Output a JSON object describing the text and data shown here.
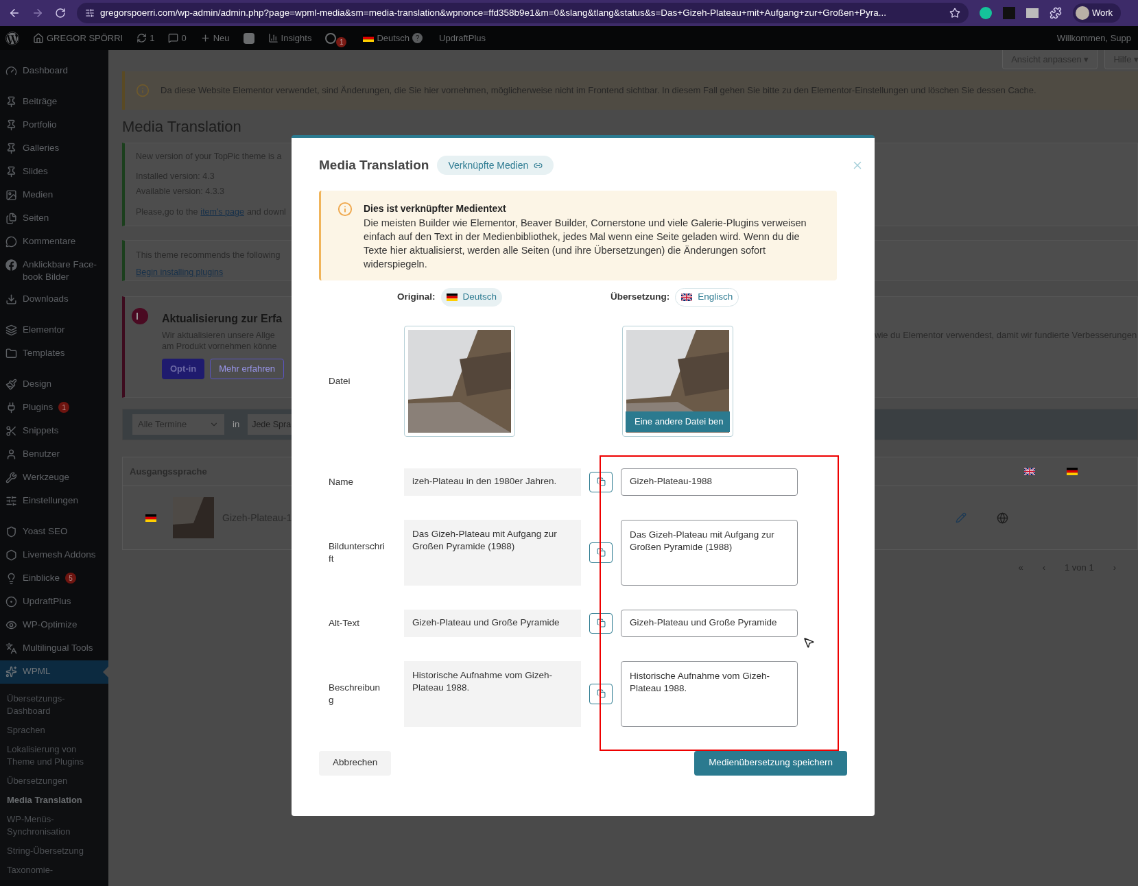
{
  "browser": {
    "url": "gregorspoerri.com/wp-admin/admin.php?page=wpml-media&sm=media-translation&wpnonce=ffd358b9e1&m=0&slang&tlang&status&s=Das+Gizeh-Plateau+mit+Aufgang+zur+Großen+Pyra...",
    "profile": "Work"
  },
  "admin_bar": {
    "site": "GREGOR SPÖRRI",
    "updates": "1",
    "comments": "0",
    "new": "Neu",
    "insights": "Insights",
    "wpml_badge": "1",
    "language": "Deutsch",
    "help": "?",
    "updraft": "UpdraftPlus",
    "welcome": "Willkommen, Supp"
  },
  "sidebar": {
    "groups": [
      [
        {
          "label": "Dashboard",
          "selected": false
        }
      ],
      [
        {
          "label": "Beiträge",
          "selected": false
        },
        {
          "label": "Portfolio",
          "selected": false
        },
        {
          "label": "Galleries",
          "selected": false
        },
        {
          "label": "Slides",
          "selected": false
        },
        {
          "label": "Medien",
          "selected": false
        },
        {
          "label": "Seiten",
          "selected": false
        },
        {
          "label": "Kommentare",
          "selected": false
        },
        {
          "label": "Anklickbare Face-book Bilder",
          "selected": false
        },
        {
          "label": "Downloads",
          "selected": false
        }
      ],
      [
        {
          "label": "Elementor",
          "selected": false
        },
        {
          "label": "Templates",
          "selected": false
        }
      ],
      [
        {
          "label": "Design",
          "selected": false
        },
        {
          "label": "Plugins",
          "badge": "1",
          "selected": false
        },
        {
          "label": "Snippets",
          "selected": false
        },
        {
          "label": "Benutzer",
          "selected": false
        },
        {
          "label": "Werkzeuge",
          "selected": false
        },
        {
          "label": "Einstellungen",
          "selected": false
        }
      ],
      [
        {
          "label": "Yoast SEO",
          "selected": false
        },
        {
          "label": "Livemesh Addons",
          "selected": false
        },
        {
          "label": "Einblicke",
          "badge": "5",
          "selected": false
        },
        {
          "label": "UpdraftPlus",
          "selected": false
        },
        {
          "label": "WP-Optimize",
          "selected": false
        },
        {
          "label": "Multilingual Tools",
          "selected": false
        },
        {
          "label": "WPML",
          "selected": true
        }
      ]
    ],
    "submenu": [
      {
        "label": "Übersetzungs-Dashboard",
        "selected": false
      },
      {
        "label": "Sprachen",
        "selected": false
      },
      {
        "label": "Lokalisierung von Theme und Plugins",
        "selected": false
      },
      {
        "label": "Übersetzungen",
        "selected": false
      },
      {
        "label": "Media Translation",
        "selected": true
      },
      {
        "label": "WP-Menüs-Synchronisation",
        "selected": false
      },
      {
        "label": "String-Übersetzung",
        "selected": false
      },
      {
        "label": "Taxonomie-",
        "selected": false
      }
    ]
  },
  "screen_options": [
    "Ansicht anpassen ▾",
    "Hilfe ▾"
  ],
  "elementor_notice": "Da diese Website Elementor verwendet, sind Änderungen, die Sie hier vornehmen, möglicherweise nicht im Frontend sichtbar. In diesem Fall gehen Sie bitte zu den Elementor-Einstellungen und löschen Sie dessen Cache.",
  "page_title": "Media Translation",
  "theme_notice": {
    "title": "New version of your TopPic theme is a",
    "installed": "Installed version: 4.3",
    "available": "Available version: 4.3.3",
    "before_link": "Please,go to the",
    "link": "item's page",
    "after_link": "and downl"
  },
  "plugins_notice": {
    "text": "This theme recommends the following",
    "link": "Begin installing plugins"
  },
  "optin_notice": {
    "title": "Aktualisierung zur Erfa",
    "line_1": "Wir aktualisieren unsere Allge",
    "line_2": "am Produkt vornehmen könne",
    "right_text": "wie du Elementor verwendest, damit wir fundierte Verbesserungen",
    "buttons": [
      "Opt-in",
      "Mehr erfahren"
    ]
  },
  "filters": {
    "date": "Alle Termine",
    "in": "in",
    "language": "Jede Spra"
  },
  "table": {
    "columns": [
      "Ausgangssprache"
    ],
    "rows": [
      {
        "title": "Gizeh-Plateau-1"
      }
    ]
  },
  "pagination": [
    "«",
    "‹",
    "1 von 1",
    "›"
  ],
  "modal": {
    "title": "Media Translation",
    "linked_badge": "Verknüpfte Medien",
    "info": {
      "title": "Dies ist verknüpfter Medientext",
      "text": "Die meisten Builder wie Elementor, Beaver Builder, Cornerstone und viele Galerie-Plugins verweisen einfach auf den Text in der Medienbibliothek, jedes Mal wenn eine Seite geladen wird. Wenn du die Texte hier aktualisierst, werden alle Seiten (und ihre Übersetzungen) die Änderungen sofort widerspiegeln."
    },
    "original_label": "Original:",
    "original_language": "Deutsch",
    "translation_label": "Übersetzung:",
    "translation_language": "Englisch",
    "rows": [
      {
        "kind": "file",
        "label": "Datei",
        "replace_button": "Eine andere Datei ben"
      },
      {
        "kind": "input",
        "label": "Name",
        "original": "izeh-Plateau in den 1980er Jahren.",
        "translation": "Gizeh-Plateau-1988"
      },
      {
        "kind": "textarea",
        "label": "Bildunterschrift",
        "original": "Das Gizeh-Plateau mit Aufgang zur Großen Pyramide (1988)",
        "translation": "Das Gizeh-Plateau mit Aufgang zur Großen Pyramide (1988)"
      },
      {
        "kind": "input",
        "label": "Alt-Text",
        "original": "Gizeh-Plateau und Große Pyramide",
        "translation": "Gizeh-Plateau und Große Pyramide"
      },
      {
        "kind": "textarea",
        "label": "Beschreibung",
        "original": "Historische Aufnahme vom Gizeh-Plateau 1988.",
        "translation": "Historische Aufnahme vom Gizeh-Plateau 1988."
      }
    ],
    "cancel": "Abbrechen",
    "save": "Medienübersetzung speichern"
  }
}
